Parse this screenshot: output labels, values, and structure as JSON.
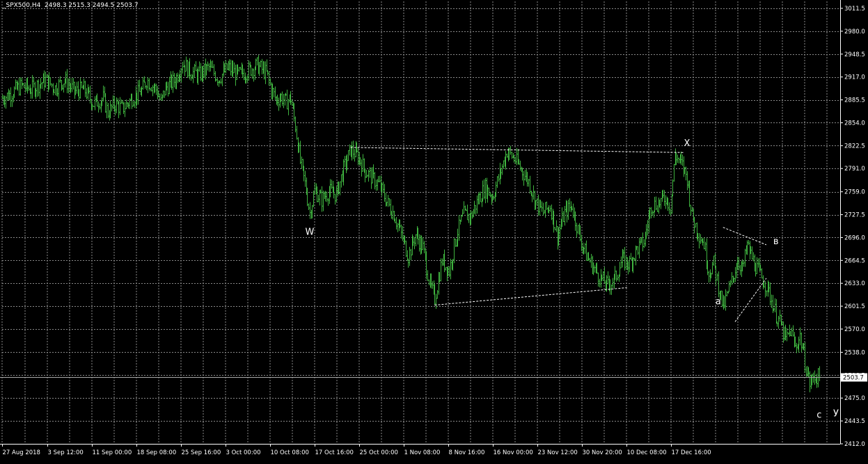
{
  "window": {
    "symbol_header": "_SPX500,H4  2498.3 2515.3 2494.5 2503.7"
  },
  "colors": {
    "background": "#000000",
    "grid": "#8a8a8a",
    "candle": "#3fb33f",
    "axis_text": "#ffffff",
    "price_line": "#aaaaaa",
    "price_label_bg": "#ffffff",
    "price_label_text": "#000000",
    "annotation": "#ffffff"
  },
  "chart_data": {
    "type": "line",
    "title": "_SPX500,H4",
    "ohlc_current": {
      "open": 2498.3,
      "high": 2515.3,
      "low": 2494.5,
      "close": 2503.7
    },
    "current_price_label": "2503.7",
    "grid": true,
    "ylim": [
      2412.0,
      3011.5
    ],
    "y_ticks": [
      "3011.5",
      "2980.0",
      "2948.5",
      "2917.0",
      "2885.5",
      "2854.0",
      "2822.5",
      "2791.0",
      "2759.0",
      "2727.5",
      "2696.0",
      "2664.5",
      "2633.0",
      "2601.5",
      "2570.0",
      "2538.0",
      "2506.5",
      "2475.0",
      "2443.5",
      "2412.0"
    ],
    "x_ticks": [
      "27 Aug 2018",
      "3 Sep 12:00",
      "11 Sep 00:00",
      "18 Sep 08:00",
      "25 Sep 16:00",
      "3 Oct 00:00",
      "10 Oct 08:00",
      "17 Oct 16:00",
      "25 Oct 00:00",
      "1 Nov 08:00",
      "8 Nov 16:00",
      "16 Nov 00:00",
      "23 Nov 12:00",
      "30 Nov 20:00",
      "10 Dec 08:00",
      "17 Dec 16:00"
    ],
    "price_path": [
      [
        0,
        2888
      ],
      [
        3,
        2893
      ],
      [
        8,
        2905
      ],
      [
        12,
        2900
      ],
      [
        18,
        2913
      ],
      [
        22,
        2902
      ],
      [
        26,
        2913
      ],
      [
        30,
        2897
      ],
      [
        34,
        2900
      ],
      [
        38,
        2880
      ],
      [
        42,
        2888
      ],
      [
        44,
        2868
      ],
      [
        47,
        2880
      ],
      [
        50,
        2873
      ],
      [
        54,
        2888
      ],
      [
        58,
        2898
      ],
      [
        60,
        2913
      ],
      [
        64,
        2900
      ],
      [
        66,
        2882
      ],
      [
        68,
        2902
      ],
      [
        72,
        2913
      ],
      [
        75,
        2937
      ],
      [
        78,
        2925
      ],
      [
        82,
        2920
      ],
      [
        86,
        2930
      ],
      [
        90,
        2915
      ],
      [
        94,
        2930
      ],
      [
        98,
        2920
      ],
      [
        102,
        2925
      ],
      [
        106,
        2933
      ],
      [
        110,
        2922
      ],
      [
        112,
        2900
      ],
      [
        114,
        2885
      ],
      [
        116,
        2890
      ],
      [
        118,
        2882
      ],
      [
        120,
        2888
      ],
      [
        122,
        2850
      ],
      [
        124,
        2800
      ],
      [
        126,
        2770
      ],
      [
        128,
        2730
      ],
      [
        130,
        2760
      ],
      [
        133,
        2748
      ],
      [
        136,
        2760
      ],
      [
        139,
        2755
      ],
      [
        142,
        2790
      ],
      [
        145,
        2817
      ],
      [
        148,
        2808
      ],
      [
        151,
        2788
      ],
      [
        154,
        2778
      ],
      [
        157,
        2768
      ],
      [
        160,
        2745
      ],
      [
        163,
        2728
      ],
      [
        166,
        2700
      ],
      [
        169,
        2670
      ],
      [
        172,
        2700
      ],
      [
        175,
        2682
      ],
      [
        178,
        2630
      ],
      [
        180,
        2612
      ],
      [
        183,
        2665
      ],
      [
        186,
        2650
      ],
      [
        189,
        2700
      ],
      [
        192,
        2728
      ],
      [
        195,
        2725
      ],
      [
        198,
        2748
      ],
      [
        201,
        2765
      ],
      [
        204,
        2752
      ],
      [
        207,
        2783
      ],
      [
        210,
        2815
      ],
      [
        213,
        2805
      ],
      [
        216,
        2790
      ],
      [
        219,
        2773
      ],
      [
        222,
        2745
      ],
      [
        225,
        2730
      ],
      [
        228,
        2740
      ],
      [
        231,
        2698
      ],
      [
        234,
        2730
      ],
      [
        237,
        2740
      ],
      [
        240,
        2700
      ],
      [
        243,
        2672
      ],
      [
        246,
        2655
      ],
      [
        249,
        2640
      ],
      [
        252,
        2630
      ],
      [
        255,
        2640
      ],
      [
        258,
        2665
      ],
      [
        261,
        2660
      ],
      [
        264,
        2680
      ],
      [
        267,
        2690
      ],
      [
        270,
        2740
      ],
      [
        273,
        2743
      ],
      [
        276,
        2752
      ],
      [
        278,
        2738
      ],
      [
        280,
        2810
      ],
      [
        283,
        2795
      ],
      [
        285,
        2778
      ],
      [
        287,
        2725
      ],
      [
        290,
        2700
      ],
      [
        292,
        2688
      ],
      [
        294,
        2648
      ],
      [
        296,
        2660
      ],
      [
        298,
        2630
      ],
      [
        300,
        2600
      ],
      [
        302,
        2620
      ],
      [
        304,
        2640
      ],
      [
        306,
        2665
      ],
      [
        308,
        2652
      ],
      [
        310,
        2685
      ],
      [
        312,
        2668
      ],
      [
        314,
        2653
      ],
      [
        316,
        2640
      ],
      [
        318,
        2630
      ],
      [
        320,
        2610
      ],
      [
        322,
        2590
      ],
      [
        324,
        2575
      ],
      [
        326,
        2555
      ],
      [
        328,
        2568
      ],
      [
        330,
        2545
      ],
      [
        332,
        2560
      ],
      [
        334,
        2525
      ],
      [
        336,
        2495
      ],
      [
        338,
        2505
      ],
      [
        340,
        2503.7
      ]
    ],
    "annotations": [
      {
        "label": "W",
        "time": 128,
        "price": 2700
      },
      {
        "label": "X",
        "time": 285,
        "price": 2822
      },
      {
        "label": "а",
        "time": 298,
        "price": 2604
      },
      {
        "label": "в",
        "time": 322,
        "price": 2687
      },
      {
        "label": "с",
        "time": 340,
        "price": 2448
      },
      {
        "label": "У",
        "time": 347,
        "price": 2450
      }
    ],
    "trendlines": [
      {
        "from": [
          145,
          2820
        ],
        "to": [
          284,
          2813
        ]
      },
      {
        "from": [
          180,
          2603
        ],
        "to": [
          260,
          2627
        ]
      },
      {
        "from": [
          300,
          2710
        ],
        "to": [
          318,
          2686
        ]
      },
      {
        "from": [
          305,
          2580
        ],
        "to": [
          318,
          2640
        ]
      }
    ]
  }
}
